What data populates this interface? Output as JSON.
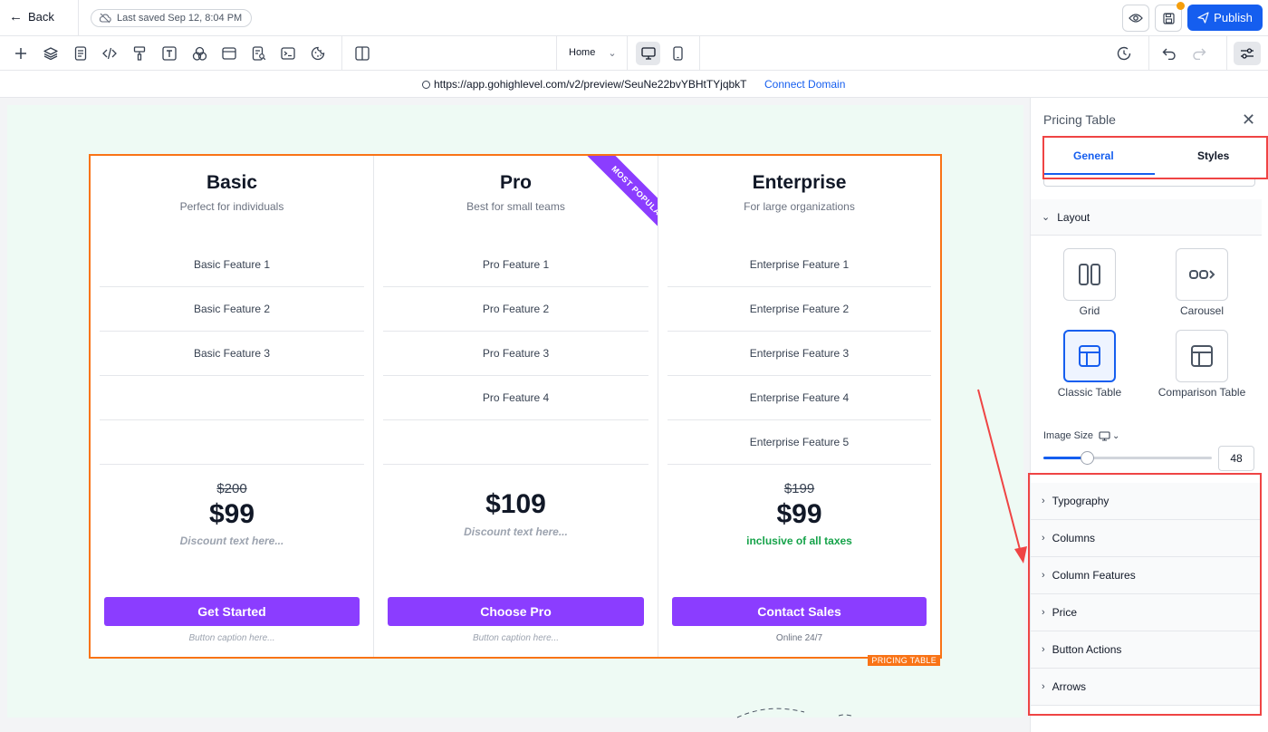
{
  "topbar": {
    "back_label": "Back",
    "saved_label": "Last saved Sep 12, 8:04 PM",
    "publish_label": "Publish"
  },
  "toolbar": {
    "page_selected": "Home"
  },
  "urlbar": {
    "url": "https://app.gohighlevel.com/v2/preview/SeuNe22bvYBHtTYjqbkT",
    "connect_label": "Connect Domain"
  },
  "pricing": {
    "badge": "PRICING TABLE",
    "columns": [
      {
        "title": "Basic",
        "subtitle": "Perfect for individuals",
        "features": [
          "Basic Feature 1",
          "Basic Feature 2",
          "Basic Feature 3",
          "",
          ""
        ],
        "old_price": "$200",
        "price": "$99",
        "discount": "Discount text here...",
        "button": "Get Started",
        "caption": "Button caption here..."
      },
      {
        "title": "Pro",
        "subtitle": "Best for small teams",
        "ribbon": "MOST POPULAR",
        "features": [
          "Pro Feature 1",
          "Pro Feature 2",
          "Pro Feature 3",
          "Pro Feature 4",
          ""
        ],
        "price": "$109",
        "discount": "Discount text here...",
        "button": "Choose Pro",
        "caption": "Button caption here..."
      },
      {
        "title": "Enterprise",
        "subtitle": "For large organizations",
        "features": [
          "Enterprise Feature 1",
          "Enterprise Feature 2",
          "Enterprise Feature 3",
          "Enterprise Feature 4",
          "Enterprise Feature 5"
        ],
        "old_price": "$199",
        "price": "$99",
        "tax_note": "inclusive of all taxes",
        "button": "Contact Sales",
        "caption": "Online 24/7"
      }
    ]
  },
  "panel": {
    "title": "Pricing Table",
    "tabs": [
      {
        "label": "General"
      },
      {
        "label": "Styles"
      }
    ],
    "name_value": "Pricing Table",
    "layout_section": "Layout",
    "layout_options": [
      {
        "label": "Grid"
      },
      {
        "label": "Carousel"
      },
      {
        "label": "Classic Table"
      },
      {
        "label": "Comparison Table"
      }
    ],
    "image_size_label": "Image Size",
    "image_size_value": "48",
    "image_size_fraction": 0.26,
    "sections": [
      {
        "label": "Typography"
      },
      {
        "label": "Columns"
      },
      {
        "label": "Column Features"
      },
      {
        "label": "Price"
      },
      {
        "label": "Button Actions"
      },
      {
        "label": "Arrows"
      }
    ]
  },
  "colors": {
    "accent": "#155eef",
    "button_purple": "#8b3dff",
    "selection_orange": "#f97316",
    "annotation_red": "#ef4444",
    "tax_green": "#16a34a"
  }
}
